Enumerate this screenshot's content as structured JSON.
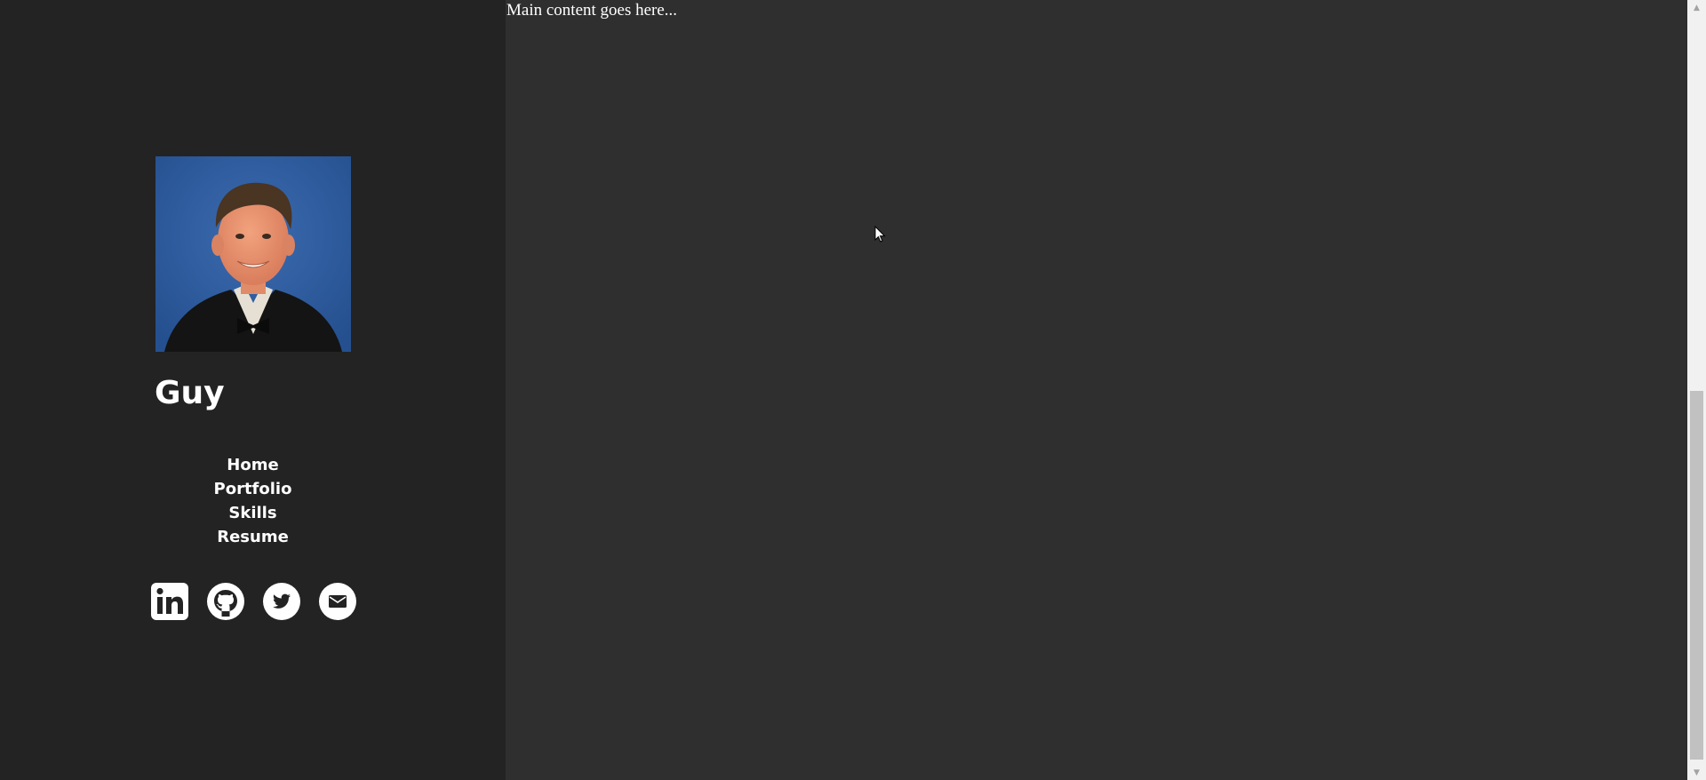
{
  "profile": {
    "name": "Guy",
    "photo_alt": "Portrait photo"
  },
  "nav": {
    "items": [
      {
        "label": "Home"
      },
      {
        "label": "Portfolio"
      },
      {
        "label": "Skills"
      },
      {
        "label": "Resume"
      }
    ]
  },
  "social": {
    "links": [
      {
        "icon": "linkedin-icon"
      },
      {
        "icon": "github-icon"
      },
      {
        "icon": "twitter-icon"
      },
      {
        "icon": "email-icon"
      }
    ]
  },
  "main": {
    "content_text": "Main content goes here..."
  },
  "colors": {
    "sidebar_bg": "#232323",
    "main_bg": "#2f2f2f",
    "text": "#ffffff"
  }
}
